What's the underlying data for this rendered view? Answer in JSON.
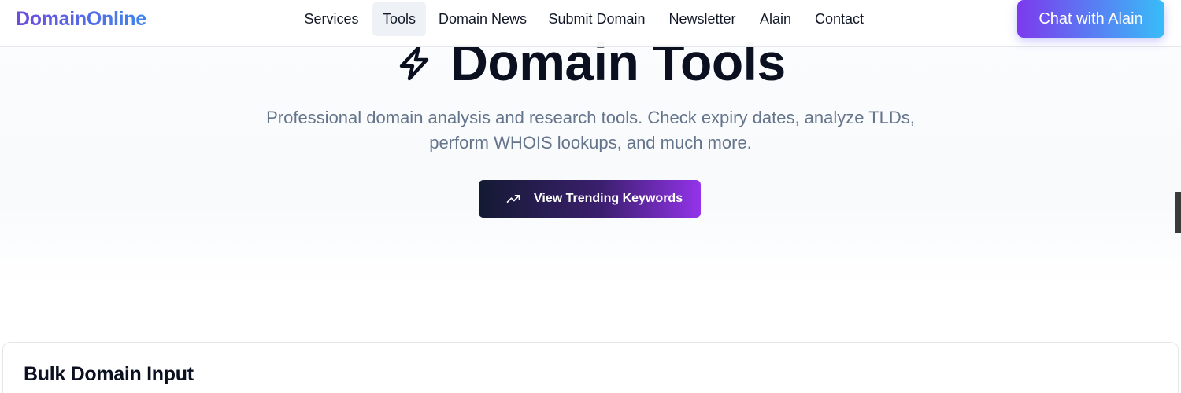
{
  "header": {
    "logo": "DomainOnline",
    "nav": [
      {
        "label": "Services",
        "active": false
      },
      {
        "label": "Tools",
        "active": true
      },
      {
        "label": "Domain News",
        "active": false
      },
      {
        "label": "Submit Domain",
        "active": false
      },
      {
        "label": "Newsletter",
        "active": false
      },
      {
        "label": "Alain",
        "active": false
      },
      {
        "label": "Contact",
        "active": false
      }
    ],
    "chat_button": "Chat with Alain"
  },
  "hero": {
    "icon": "lightning-bolt-icon",
    "title": "Domain Tools",
    "subtitle_line1": "Professional domain analysis and research tools. Check expiry dates, analyze TLDs,",
    "subtitle_line2": "perform WHOIS lookups, and much more.",
    "cta_label": "View Trending Keywords",
    "cta_icon": "trending-up-icon"
  },
  "bulk": {
    "title": "Bulk Domain Input"
  },
  "colors": {
    "brand_purple": "#7c3aed",
    "brand_blue": "#38bdf8",
    "title_text": "#0b1020",
    "muted_text": "#64748b"
  }
}
